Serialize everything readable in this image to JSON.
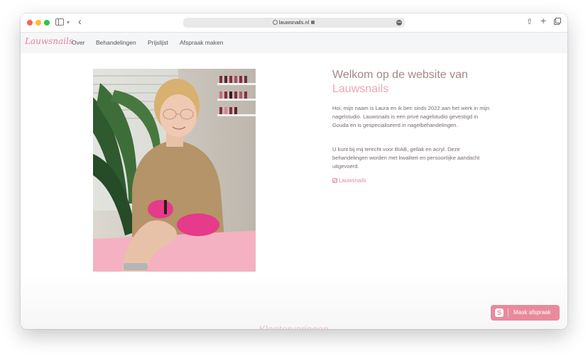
{
  "browser": {
    "url": "lauwsnails.nl"
  },
  "nav": {
    "logo": "Lauwsnails",
    "items": [
      "Over",
      "Behandelingen",
      "Prijslijst",
      "Afspraak maken"
    ]
  },
  "hero": {
    "heading_line1": "Welkom op de website van",
    "heading_line2": "Lauwsnails",
    "paragraph1": "Hoi, mijn naam is Laura en ik ben sinds 2022 aan het werk in mijn nagelstudio. Lauwsnails is een privé nagelstudio gevestigd in Gouda en is gespecialiseerd in nagelbehandelingen.",
    "paragraph2": "U kunt bij mij terecht voor BIAB, gellak en acryl. Deze behandelingen worden met kwaliteit en persoonlijke aandacht uitgevoerd.",
    "instagram_label": "Lauwsnails"
  },
  "section": {
    "title": "Klantervaringen"
  },
  "cta": {
    "label": "Maak afspraak"
  },
  "colors": {
    "accent": "#e98a9c",
    "heading": "#a48888",
    "heading_pink": "#eda7b7"
  }
}
